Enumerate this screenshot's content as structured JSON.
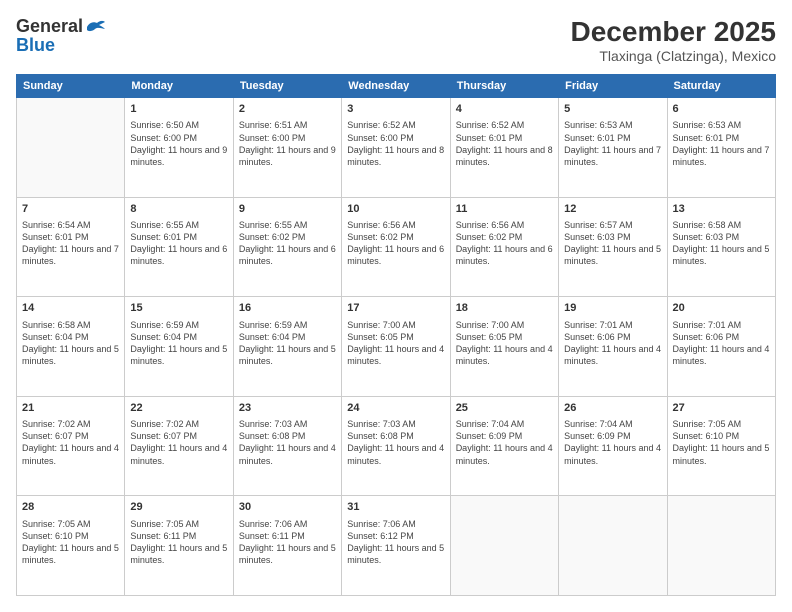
{
  "header": {
    "logo_line1": "General",
    "logo_line2": "Blue",
    "month": "December 2025",
    "location": "Tlaxinga (Clatzinga), Mexico"
  },
  "weekdays": [
    "Sunday",
    "Monday",
    "Tuesday",
    "Wednesday",
    "Thursday",
    "Friday",
    "Saturday"
  ],
  "weeks": [
    [
      {
        "day": "",
        "sunrise": "",
        "sunset": "",
        "daylight": ""
      },
      {
        "day": "1",
        "sunrise": "Sunrise: 6:50 AM",
        "sunset": "Sunset: 6:00 PM",
        "daylight": "Daylight: 11 hours and 9 minutes."
      },
      {
        "day": "2",
        "sunrise": "Sunrise: 6:51 AM",
        "sunset": "Sunset: 6:00 PM",
        "daylight": "Daylight: 11 hours and 9 minutes."
      },
      {
        "day": "3",
        "sunrise": "Sunrise: 6:52 AM",
        "sunset": "Sunset: 6:00 PM",
        "daylight": "Daylight: 11 hours and 8 minutes."
      },
      {
        "day": "4",
        "sunrise": "Sunrise: 6:52 AM",
        "sunset": "Sunset: 6:01 PM",
        "daylight": "Daylight: 11 hours and 8 minutes."
      },
      {
        "day": "5",
        "sunrise": "Sunrise: 6:53 AM",
        "sunset": "Sunset: 6:01 PM",
        "daylight": "Daylight: 11 hours and 7 minutes."
      },
      {
        "day": "6",
        "sunrise": "Sunrise: 6:53 AM",
        "sunset": "Sunset: 6:01 PM",
        "daylight": "Daylight: 11 hours and 7 minutes."
      }
    ],
    [
      {
        "day": "7",
        "sunrise": "Sunrise: 6:54 AM",
        "sunset": "Sunset: 6:01 PM",
        "daylight": "Daylight: 11 hours and 7 minutes."
      },
      {
        "day": "8",
        "sunrise": "Sunrise: 6:55 AM",
        "sunset": "Sunset: 6:01 PM",
        "daylight": "Daylight: 11 hours and 6 minutes."
      },
      {
        "day": "9",
        "sunrise": "Sunrise: 6:55 AM",
        "sunset": "Sunset: 6:02 PM",
        "daylight": "Daylight: 11 hours and 6 minutes."
      },
      {
        "day": "10",
        "sunrise": "Sunrise: 6:56 AM",
        "sunset": "Sunset: 6:02 PM",
        "daylight": "Daylight: 11 hours and 6 minutes."
      },
      {
        "day": "11",
        "sunrise": "Sunrise: 6:56 AM",
        "sunset": "Sunset: 6:02 PM",
        "daylight": "Daylight: 11 hours and 6 minutes."
      },
      {
        "day": "12",
        "sunrise": "Sunrise: 6:57 AM",
        "sunset": "Sunset: 6:03 PM",
        "daylight": "Daylight: 11 hours and 5 minutes."
      },
      {
        "day": "13",
        "sunrise": "Sunrise: 6:58 AM",
        "sunset": "Sunset: 6:03 PM",
        "daylight": "Daylight: 11 hours and 5 minutes."
      }
    ],
    [
      {
        "day": "14",
        "sunrise": "Sunrise: 6:58 AM",
        "sunset": "Sunset: 6:04 PM",
        "daylight": "Daylight: 11 hours and 5 minutes."
      },
      {
        "day": "15",
        "sunrise": "Sunrise: 6:59 AM",
        "sunset": "Sunset: 6:04 PM",
        "daylight": "Daylight: 11 hours and 5 minutes."
      },
      {
        "day": "16",
        "sunrise": "Sunrise: 6:59 AM",
        "sunset": "Sunset: 6:04 PM",
        "daylight": "Daylight: 11 hours and 5 minutes."
      },
      {
        "day": "17",
        "sunrise": "Sunrise: 7:00 AM",
        "sunset": "Sunset: 6:05 PM",
        "daylight": "Daylight: 11 hours and 4 minutes."
      },
      {
        "day": "18",
        "sunrise": "Sunrise: 7:00 AM",
        "sunset": "Sunset: 6:05 PM",
        "daylight": "Daylight: 11 hours and 4 minutes."
      },
      {
        "day": "19",
        "sunrise": "Sunrise: 7:01 AM",
        "sunset": "Sunset: 6:06 PM",
        "daylight": "Daylight: 11 hours and 4 minutes."
      },
      {
        "day": "20",
        "sunrise": "Sunrise: 7:01 AM",
        "sunset": "Sunset: 6:06 PM",
        "daylight": "Daylight: 11 hours and 4 minutes."
      }
    ],
    [
      {
        "day": "21",
        "sunrise": "Sunrise: 7:02 AM",
        "sunset": "Sunset: 6:07 PM",
        "daylight": "Daylight: 11 hours and 4 minutes."
      },
      {
        "day": "22",
        "sunrise": "Sunrise: 7:02 AM",
        "sunset": "Sunset: 6:07 PM",
        "daylight": "Daylight: 11 hours and 4 minutes."
      },
      {
        "day": "23",
        "sunrise": "Sunrise: 7:03 AM",
        "sunset": "Sunset: 6:08 PM",
        "daylight": "Daylight: 11 hours and 4 minutes."
      },
      {
        "day": "24",
        "sunrise": "Sunrise: 7:03 AM",
        "sunset": "Sunset: 6:08 PM",
        "daylight": "Daylight: 11 hours and 4 minutes."
      },
      {
        "day": "25",
        "sunrise": "Sunrise: 7:04 AM",
        "sunset": "Sunset: 6:09 PM",
        "daylight": "Daylight: 11 hours and 4 minutes."
      },
      {
        "day": "26",
        "sunrise": "Sunrise: 7:04 AM",
        "sunset": "Sunset: 6:09 PM",
        "daylight": "Daylight: 11 hours and 4 minutes."
      },
      {
        "day": "27",
        "sunrise": "Sunrise: 7:05 AM",
        "sunset": "Sunset: 6:10 PM",
        "daylight": "Daylight: 11 hours and 5 minutes."
      }
    ],
    [
      {
        "day": "28",
        "sunrise": "Sunrise: 7:05 AM",
        "sunset": "Sunset: 6:10 PM",
        "daylight": "Daylight: 11 hours and 5 minutes."
      },
      {
        "day": "29",
        "sunrise": "Sunrise: 7:05 AM",
        "sunset": "Sunset: 6:11 PM",
        "daylight": "Daylight: 11 hours and 5 minutes."
      },
      {
        "day": "30",
        "sunrise": "Sunrise: 7:06 AM",
        "sunset": "Sunset: 6:11 PM",
        "daylight": "Daylight: 11 hours and 5 minutes."
      },
      {
        "day": "31",
        "sunrise": "Sunrise: 7:06 AM",
        "sunset": "Sunset: 6:12 PM",
        "daylight": "Daylight: 11 hours and 5 minutes."
      },
      {
        "day": "",
        "sunrise": "",
        "sunset": "",
        "daylight": ""
      },
      {
        "day": "",
        "sunrise": "",
        "sunset": "",
        "daylight": ""
      },
      {
        "day": "",
        "sunrise": "",
        "sunset": "",
        "daylight": ""
      }
    ]
  ]
}
